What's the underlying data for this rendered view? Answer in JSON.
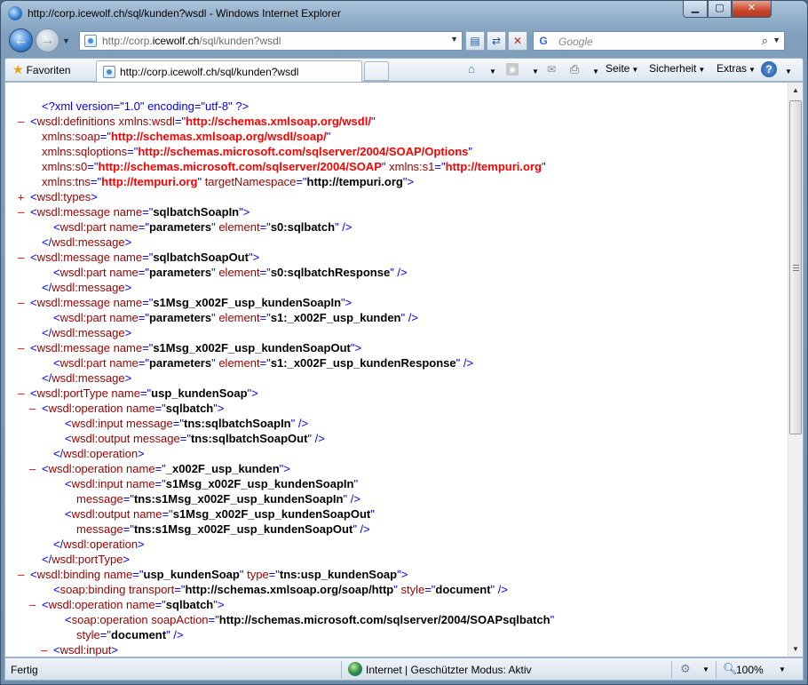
{
  "window": {
    "title": "http://corp.icewolf.ch/sql/kunden?wsdl - Windows Internet Explorer"
  },
  "title_buttons": {
    "minimize": "▁",
    "maximize": "▢",
    "close": "✕"
  },
  "nav": {
    "back": "←",
    "forward": "→",
    "address_prefix": "http://corp.",
    "address_domain": "icewolf.ch",
    "address_suffix": "/sql/kunden?wsdl",
    "search_placeholder": "Google"
  },
  "commandbar": {
    "favorites": "Favoriten",
    "tab_label": "http://corp.icewolf.ch/sql/kunden?wsdl",
    "seite": "Seite",
    "sicherheit": "Sicherheit",
    "extras": "Extras"
  },
  "xml_lines": [
    {
      "m": "",
      "parts": [
        [
          "pi",
          "<?xml version=\"1.0\" encoding=\"utf-8\" ?>"
        ]
      ]
    },
    {
      "m": "-",
      "parts": [
        [
          "b",
          "<"
        ],
        [
          "t",
          "wsdl:definitions"
        ],
        [
          "an",
          " xmlns:wsdl"
        ],
        [
          "b",
          "=\""
        ],
        [
          "avr",
          "http://schemas.xmlsoap.org/wsdl/"
        ],
        [
          "b",
          "\""
        ]
      ]
    },
    {
      "m": "",
      "parts": [
        [
          "an",
          "xmlns:soap"
        ],
        [
          "b",
          "=\""
        ],
        [
          "avr",
          "http://schemas.xmlsoap.org/wsdl/soap/"
        ],
        [
          "b",
          "\""
        ]
      ]
    },
    {
      "m": "",
      "parts": [
        [
          "an",
          "xmlns:sqloptions"
        ],
        [
          "b",
          "=\""
        ],
        [
          "avr",
          "http://schemas.microsoft.com/sqlserver/2004/SOAP/Options"
        ],
        [
          "b",
          "\""
        ]
      ]
    },
    {
      "m": "",
      "parts": [
        [
          "an",
          "xmlns:s0"
        ],
        [
          "b",
          "=\""
        ],
        [
          "avr",
          "http://schemas.microsoft.com/sqlserver/2004/SOAP"
        ],
        [
          "b",
          "\""
        ],
        [
          "an",
          " xmlns:s1"
        ],
        [
          "b",
          "=\""
        ],
        [
          "avr",
          "http://tempuri.org"
        ],
        [
          "b",
          "\""
        ]
      ]
    },
    {
      "m": "",
      "parts": [
        [
          "an",
          "xmlns:tns"
        ],
        [
          "b",
          "=\""
        ],
        [
          "avr",
          "http://tempuri.org"
        ],
        [
          "b",
          "\""
        ],
        [
          "an",
          " targetNamespace"
        ],
        [
          "b",
          "=\""
        ],
        [
          "av",
          "http://tempuri.org"
        ],
        [
          "b",
          "\">"
        ]
      ]
    },
    {
      "m": "+",
      "parts": [
        [
          "b",
          "<"
        ],
        [
          "t",
          "wsdl:types"
        ],
        [
          "b",
          ">"
        ]
      ]
    },
    {
      "m": "-",
      "parts": [
        [
          "b",
          "<"
        ],
        [
          "t",
          "wsdl:message"
        ],
        [
          "an",
          " name"
        ],
        [
          "b",
          "=\""
        ],
        [
          "av",
          "sqlbatchSoapIn"
        ],
        [
          "b",
          "\">"
        ]
      ]
    },
    {
      "m": "",
      "parts": [
        [
          "b",
          "<"
        ],
        [
          "t",
          "wsdl:part"
        ],
        [
          "an",
          " name"
        ],
        [
          "b",
          "=\""
        ],
        [
          "av",
          "parameters"
        ],
        [
          "b",
          "\""
        ],
        [
          "an",
          " element"
        ],
        [
          "b",
          "=\""
        ],
        [
          "av",
          "s0:sqlbatch"
        ],
        [
          "b",
          "\" />"
        ]
      ]
    },
    {
      "m": "",
      "parts": [
        [
          "b",
          "</"
        ],
        [
          "t",
          "wsdl:message"
        ],
        [
          "b",
          ">"
        ]
      ]
    },
    {
      "m": "-",
      "parts": [
        [
          "b",
          "<"
        ],
        [
          "t",
          "wsdl:message"
        ],
        [
          "an",
          " name"
        ],
        [
          "b",
          "=\""
        ],
        [
          "av",
          "sqlbatchSoapOut"
        ],
        [
          "b",
          "\">"
        ]
      ]
    },
    {
      "m": "",
      "parts": [
        [
          "b",
          "<"
        ],
        [
          "t",
          "wsdl:part"
        ],
        [
          "an",
          " name"
        ],
        [
          "b",
          "=\""
        ],
        [
          "av",
          "parameters"
        ],
        [
          "b",
          "\""
        ],
        [
          "an",
          " element"
        ],
        [
          "b",
          "=\""
        ],
        [
          "av",
          "s0:sqlbatchResponse"
        ],
        [
          "b",
          "\" />"
        ]
      ]
    },
    {
      "m": "",
      "parts": [
        [
          "b",
          "</"
        ],
        [
          "t",
          "wsdl:message"
        ],
        [
          "b",
          ">"
        ]
      ]
    },
    {
      "m": "-",
      "parts": [
        [
          "b",
          "<"
        ],
        [
          "t",
          "wsdl:message"
        ],
        [
          "an",
          " name"
        ],
        [
          "b",
          "=\""
        ],
        [
          "av",
          "s1Msg_x002F_usp_kundenSoapIn"
        ],
        [
          "b",
          "\">"
        ]
      ]
    },
    {
      "m": "",
      "parts": [
        [
          "b",
          "<"
        ],
        [
          "t",
          "wsdl:part"
        ],
        [
          "an",
          " name"
        ],
        [
          "b",
          "=\""
        ],
        [
          "av",
          "parameters"
        ],
        [
          "b",
          "\""
        ],
        [
          "an",
          " element"
        ],
        [
          "b",
          "=\""
        ],
        [
          "av",
          "s1:_x002F_usp_kunden"
        ],
        [
          "b",
          "\" />"
        ]
      ]
    },
    {
      "m": "",
      "parts": [
        [
          "b",
          "</"
        ],
        [
          "t",
          "wsdl:message"
        ],
        [
          "b",
          ">"
        ]
      ]
    },
    {
      "m": "-",
      "parts": [
        [
          "b",
          "<"
        ],
        [
          "t",
          "wsdl:message"
        ],
        [
          "an",
          " name"
        ],
        [
          "b",
          "=\""
        ],
        [
          "av",
          "s1Msg_x002F_usp_kundenSoapOut"
        ],
        [
          "b",
          "\">"
        ]
      ]
    },
    {
      "m": "",
      "parts": [
        [
          "b",
          "<"
        ],
        [
          "t",
          "wsdl:part"
        ],
        [
          "an",
          " name"
        ],
        [
          "b",
          "=\""
        ],
        [
          "av",
          "parameters"
        ],
        [
          "b",
          "\""
        ],
        [
          "an",
          " element"
        ],
        [
          "b",
          "=\""
        ],
        [
          "av",
          "s1:_x002F_usp_kundenResponse"
        ],
        [
          "b",
          "\" />"
        ]
      ]
    },
    {
      "m": "",
      "parts": [
        [
          "b",
          "</"
        ],
        [
          "t",
          "wsdl:message"
        ],
        [
          "b",
          ">"
        ]
      ]
    },
    {
      "m": "-",
      "parts": [
        [
          "b",
          "<"
        ],
        [
          "t",
          "wsdl:portType"
        ],
        [
          "an",
          " name"
        ],
        [
          "b",
          "=\""
        ],
        [
          "av",
          "usp_kundenSoap"
        ],
        [
          "b",
          "\">"
        ]
      ]
    },
    {
      "m": "-",
      "parts": [
        [
          "b",
          "<"
        ],
        [
          "t",
          "wsdl:operation"
        ],
        [
          "an",
          " name"
        ],
        [
          "b",
          "=\""
        ],
        [
          "av",
          "sqlbatch"
        ],
        [
          "b",
          "\">"
        ]
      ]
    },
    {
      "m": "",
      "parts": [
        [
          "b",
          "<"
        ],
        [
          "t",
          "wsdl:input"
        ],
        [
          "an",
          " message"
        ],
        [
          "b",
          "=\""
        ],
        [
          "av",
          "tns:sqlbatchSoapIn"
        ],
        [
          "b",
          "\" />"
        ]
      ]
    },
    {
      "m": "",
      "parts": [
        [
          "b",
          "<"
        ],
        [
          "t",
          "wsdl:output"
        ],
        [
          "an",
          " message"
        ],
        [
          "b",
          "=\""
        ],
        [
          "av",
          "tns:sqlbatchSoapOut"
        ],
        [
          "b",
          "\" />"
        ]
      ]
    },
    {
      "m": "",
      "parts": [
        [
          "b",
          "</"
        ],
        [
          "t",
          "wsdl:operation"
        ],
        [
          "b",
          ">"
        ]
      ]
    },
    {
      "m": "-",
      "parts": [
        [
          "b",
          "<"
        ],
        [
          "t",
          "wsdl:operation"
        ],
        [
          "an",
          " name"
        ],
        [
          "b",
          "=\""
        ],
        [
          "av",
          "_x002F_usp_kunden"
        ],
        [
          "b",
          "\">"
        ]
      ]
    },
    {
      "m": "",
      "parts": [
        [
          "b",
          "<"
        ],
        [
          "t",
          "wsdl:input"
        ],
        [
          "an",
          " name"
        ],
        [
          "b",
          "=\""
        ],
        [
          "av",
          "s1Msg_x002F_usp_kundenSoapIn"
        ],
        [
          "b",
          "\""
        ]
      ]
    },
    {
      "m": "",
      "parts": [
        [
          "an",
          "message"
        ],
        [
          "b",
          "=\""
        ],
        [
          "av",
          "tns:s1Msg_x002F_usp_kundenSoapIn"
        ],
        [
          "b",
          "\" />"
        ]
      ]
    },
    {
      "m": "",
      "parts": [
        [
          "b",
          "<"
        ],
        [
          "t",
          "wsdl:output"
        ],
        [
          "an",
          " name"
        ],
        [
          "b",
          "=\""
        ],
        [
          "av",
          "s1Msg_x002F_usp_kundenSoapOut"
        ],
        [
          "b",
          "\""
        ]
      ]
    },
    {
      "m": "",
      "parts": [
        [
          "an",
          "message"
        ],
        [
          "b",
          "=\""
        ],
        [
          "av",
          "tns:s1Msg_x002F_usp_kundenSoapOut"
        ],
        [
          "b",
          "\" />"
        ]
      ]
    },
    {
      "m": "",
      "parts": [
        [
          "b",
          "</"
        ],
        [
          "t",
          "wsdl:operation"
        ],
        [
          "b",
          ">"
        ]
      ]
    },
    {
      "m": "",
      "parts": [
        [
          "b",
          "</"
        ],
        [
          "t",
          "wsdl:portType"
        ],
        [
          "b",
          ">"
        ]
      ]
    },
    {
      "m": "-",
      "parts": [
        [
          "b",
          "<"
        ],
        [
          "t",
          "wsdl:binding"
        ],
        [
          "an",
          " name"
        ],
        [
          "b",
          "=\""
        ],
        [
          "av",
          "usp_kundenSoap"
        ],
        [
          "b",
          "\""
        ],
        [
          "an",
          " type"
        ],
        [
          "b",
          "=\""
        ],
        [
          "av",
          "tns:usp_kundenSoap"
        ],
        [
          "b",
          "\">"
        ]
      ]
    },
    {
      "m": "",
      "parts": [
        [
          "b",
          "<"
        ],
        [
          "t",
          "soap:binding"
        ],
        [
          "an",
          " transport"
        ],
        [
          "b",
          "=\""
        ],
        [
          "av",
          "http://schemas.xmlsoap.org/soap/http"
        ],
        [
          "b",
          "\""
        ],
        [
          "an",
          " style"
        ],
        [
          "b",
          "=\""
        ],
        [
          "av",
          "document"
        ],
        [
          "b",
          "\" />"
        ]
      ]
    },
    {
      "m": "-",
      "parts": [
        [
          "b",
          "<"
        ],
        [
          "t",
          "wsdl:operation"
        ],
        [
          "an",
          " name"
        ],
        [
          "b",
          "=\""
        ],
        [
          "av",
          "sqlbatch"
        ],
        [
          "b",
          "\">"
        ]
      ]
    },
    {
      "m": "",
      "parts": [
        [
          "b",
          "<"
        ],
        [
          "t",
          "soap:operation"
        ],
        [
          "an",
          " soapAction"
        ],
        [
          "b",
          "=\""
        ],
        [
          "av",
          "http://schemas.microsoft.com/sqlserver/2004/SOAPsqlbatch"
        ],
        [
          "b",
          "\""
        ]
      ]
    },
    {
      "m": "",
      "parts": [
        [
          "an",
          "style"
        ],
        [
          "b",
          "=\""
        ],
        [
          "av",
          "document"
        ],
        [
          "b",
          "\" />"
        ]
      ]
    },
    {
      "m": "-",
      "parts": [
        [
          "b",
          "<"
        ],
        [
          "t",
          "wsdl:input"
        ],
        [
          "b",
          ">"
        ]
      ]
    }
  ],
  "status": {
    "left": "Fertig",
    "zone": "Internet | Geschützter Modus: Aktiv",
    "zoom": "100%"
  }
}
